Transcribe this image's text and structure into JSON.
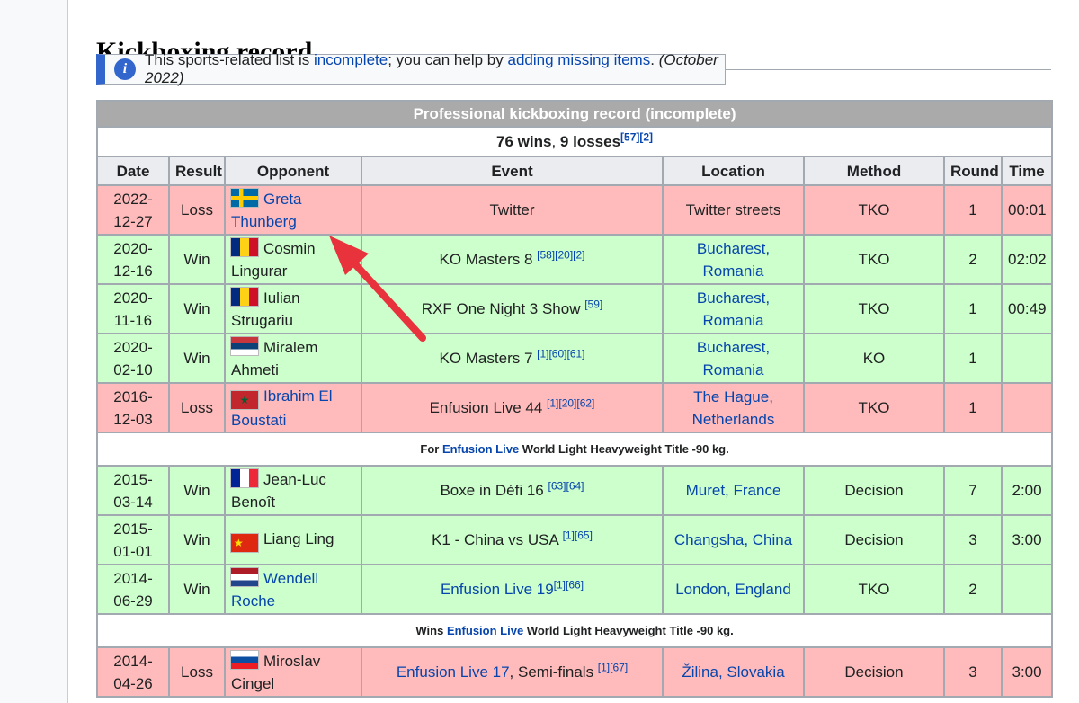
{
  "heading": "Kickboxing record",
  "ambox": {
    "icon": "info-icon",
    "text_before": "This sports-related list is ",
    "link1": "incomplete",
    "text_middle": "; you can help by ",
    "link2": "adding missing items",
    "text_after": ". ",
    "date": "(October 2022)"
  },
  "table": {
    "caption": "Professional kickboxing record (incomplete)",
    "summary": {
      "wins": "76 wins",
      "sep": ", ",
      "losses": "9 losses",
      "refs": "[57][2]"
    },
    "headers": [
      "Date",
      "Result",
      "Opponent",
      "Event",
      "Location",
      "Method",
      "Round",
      "Time"
    ],
    "rows": [
      {
        "type": "bout",
        "result_class": "loss",
        "date": "2022-12-27",
        "result": "Loss",
        "flag": "sweden",
        "opponent": "Greta Thunberg",
        "opponent_link": true,
        "event": "Twitter",
        "event_link": false,
        "event_extra": "",
        "refs": "",
        "location": "Twitter streets",
        "location_link": false,
        "method": "TKO",
        "round": "1",
        "time": "00:01"
      },
      {
        "type": "bout",
        "result_class": "win",
        "date": "2020-12-16",
        "result": "Win",
        "flag": "romania",
        "opponent": "Cosmin Lingurar",
        "opponent_link": false,
        "event": "KO Masters 8 ",
        "event_link": false,
        "event_extra": "",
        "refs": "[58][20][2]",
        "location": "Bucharest, Romania",
        "location_link": true,
        "method": "TKO",
        "round": "2",
        "time": "02:02"
      },
      {
        "type": "bout",
        "result_class": "win",
        "date": "2020-11-16",
        "result": "Win",
        "flag": "romania",
        "opponent": "Iulian Strugariu",
        "opponent_link": false,
        "event": "RXF One Night 3 Show ",
        "event_link": false,
        "event_extra": "",
        "refs": "[59]",
        "location": "Bucharest, Romania",
        "location_link": true,
        "method": "TKO",
        "round": "1",
        "time": "00:49"
      },
      {
        "type": "bout",
        "result_class": "win",
        "date": "2020-02-10",
        "result": "Win",
        "flag": "serbia",
        "opponent": "Miralem Ahmeti",
        "opponent_link": false,
        "event": "KO Masters 7 ",
        "event_link": false,
        "event_extra": "",
        "refs": "[1][60][61]",
        "location": "Bucharest, Romania",
        "location_link": true,
        "method": "KO",
        "round": "1",
        "time": ""
      },
      {
        "type": "bout",
        "result_class": "loss",
        "date": "2016-12-03",
        "result": "Loss",
        "flag": "morocco",
        "opponent": "Ibrahim El Boustati",
        "opponent_link": true,
        "event": "Enfusion Live 44 ",
        "event_link": false,
        "event_extra": "",
        "refs": "[1][20][62]",
        "location": "The Hague, Netherlands",
        "location_link": true,
        "method": "TKO",
        "round": "1",
        "time": ""
      },
      {
        "type": "note",
        "pre": "For ",
        "link": "Enfusion Live",
        "post": " World Light Heavyweight Title -90 kg."
      },
      {
        "type": "bout",
        "result_class": "win",
        "date": "2015-03-14",
        "result": "Win",
        "flag": "france",
        "opponent": "Jean-Luc Benoît",
        "opponent_link": false,
        "event": "Boxe in Défi 16 ",
        "event_link": false,
        "event_extra": "",
        "refs": "[63][64]",
        "location": "Muret, France",
        "location_link": true,
        "method": "Decision",
        "round": "7",
        "time": "2:00"
      },
      {
        "type": "bout",
        "result_class": "win",
        "date": "2015-01-01",
        "result": "Win",
        "flag": "china",
        "opponent": "Liang Ling",
        "opponent_link": false,
        "event": "K1 - China vs USA ",
        "event_link": false,
        "event_extra": "",
        "refs": "[1][65]",
        "location": "Changsha, China",
        "location_link": true,
        "method": "Decision",
        "round": "3",
        "time": "3:00"
      },
      {
        "type": "bout",
        "result_class": "win",
        "date": "2014-06-29",
        "result": "Win",
        "flag": "netherlands",
        "opponent": "Wendell Roche",
        "opponent_link": true,
        "event": "Enfusion Live 19",
        "event_link": true,
        "event_extra": "",
        "refs": "[1][66]",
        "location": "London, England",
        "location_link": true,
        "method": "TKO",
        "round": "2",
        "time": ""
      },
      {
        "type": "note",
        "pre": "Wins ",
        "link": "Enfusion Live",
        "post": " World Light Heavyweight Title -90 kg."
      },
      {
        "type": "bout",
        "result_class": "loss",
        "date": "2014-04-26",
        "result": "Loss",
        "flag": "slovakia",
        "opponent": "Miroslav Cingel",
        "opponent_link": false,
        "event": "Enfusion Live 17",
        "event_link": true,
        "event_extra": ", Semi-finals ",
        "refs": "[1][67]",
        "location": "Žilina, Slovakia",
        "location_link": true,
        "method": "Decision",
        "round": "3",
        "time": "3:00"
      }
    ]
  },
  "annotation": {
    "arrow_color": "#e8323c",
    "target": "Greta Thunberg"
  },
  "colors": {
    "loss": "#ffbbbb",
    "win": "#ccffcc",
    "link": "#0645ad",
    "caption_bg": "#aaaaaa"
  }
}
